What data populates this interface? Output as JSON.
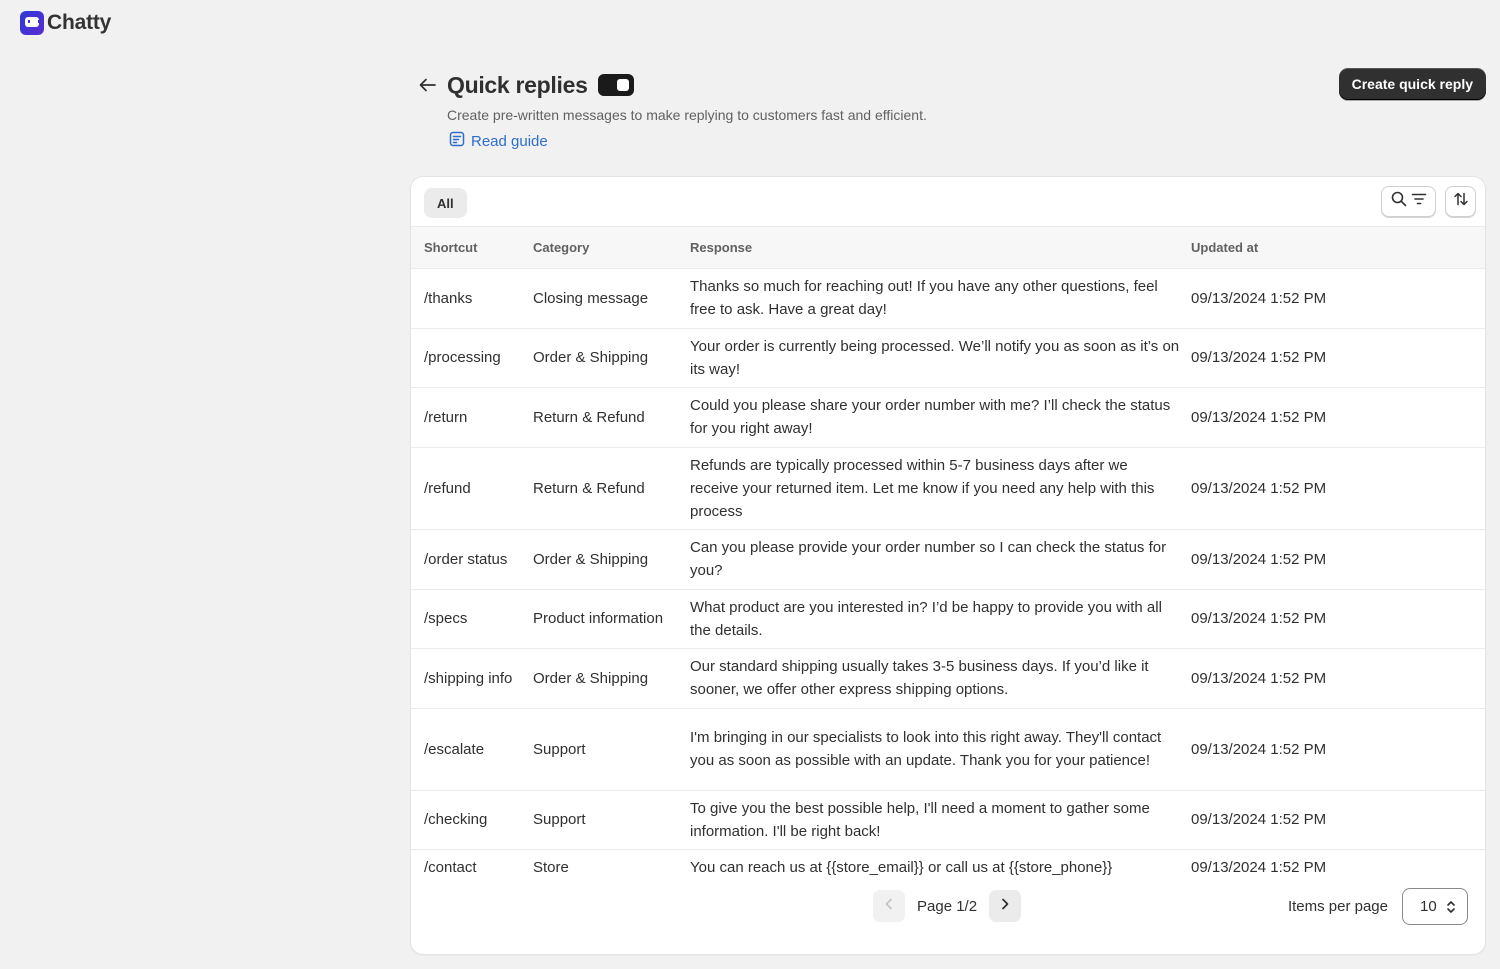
{
  "app": {
    "name": "Chatty"
  },
  "header": {
    "title": "Quick replies",
    "subtitle": "Create pre-written messages to make replying to customers fast and efficient.",
    "guide_link": "Read guide",
    "create_button": "Create quick reply",
    "toggle_on": true
  },
  "toolbar": {
    "tab_all": "All"
  },
  "table": {
    "columns": [
      "Shortcut",
      "Category",
      "Response",
      "Updated at"
    ],
    "rows": [
      {
        "shortcut": "/thanks",
        "category": "Closing message",
        "response": "Thanks so much for reaching out! If you have any other questions, feel free to ask. Have a great day!",
        "updated": "09/13/2024 1:52 PM"
      },
      {
        "shortcut": "/processing",
        "category": "Order & Shipping",
        "response": "Your order is currently being processed. We’ll notify you as soon as it’s on its way!",
        "updated": "09/13/2024 1:52 PM"
      },
      {
        "shortcut": "/return",
        "category": "Return & Refund",
        "response": "Could you please share your order number with me? I’ll check the status for you right away!",
        "updated": "09/13/2024 1:52 PM"
      },
      {
        "shortcut": "/refund",
        "category": "Return & Refund",
        "response": "Refunds are typically processed within 5-7 business days after we receive your returned item. Let me know if you need any help with this process",
        "updated": "09/13/2024 1:52 PM"
      },
      {
        "shortcut": "/order status",
        "category": "Order & Shipping",
        "response": "Can you please provide your order number so I can check the status for you?",
        "updated": "09/13/2024 1:52 PM"
      },
      {
        "shortcut": "/specs",
        "category": "Product information",
        "response": "What product are you interested in? I’d be happy to provide you with all the details.",
        "updated": "09/13/2024 1:52 PM"
      },
      {
        "shortcut": "/shipping info",
        "category": "Order & Shipping",
        "response": "Our standard shipping usually takes 3-5 business days. If you’d like it sooner, we offer other express shipping options.",
        "updated": "09/13/2024 1:52 PM"
      },
      {
        "shortcut": "/escalate",
        "category": "Support",
        "response": "I'm bringing in our specialists to look into this right away. They'll contact you as soon as possible with an update. Thank you for your patience!",
        "updated": "09/13/2024 1:52 PM"
      },
      {
        "shortcut": "/checking",
        "category": "Support",
        "response": "To give you the best possible help, I'll need a moment to gather some information. I'll be right back!",
        "updated": "09/13/2024 1:52 PM"
      },
      {
        "shortcut": "/contact",
        "category": "Store",
        "response": "You can reach us at {{store_email}} or call us at {{store_phone}}",
        "updated": "09/13/2024 1:52 PM"
      }
    ]
  },
  "pagination": {
    "label": "Page 1/2",
    "items_per_page_label": "Items per page",
    "items_per_page": "10"
  },
  "icons": {
    "back": "arrow-left-icon",
    "guide": "document-icon",
    "search": "search-icon",
    "filter": "filter-lines-icon",
    "sort": "sort-arrows-icon",
    "prev": "chevron-left-icon",
    "next": "chevron-right-icon",
    "select": "chevron-up-down-icon"
  }
}
